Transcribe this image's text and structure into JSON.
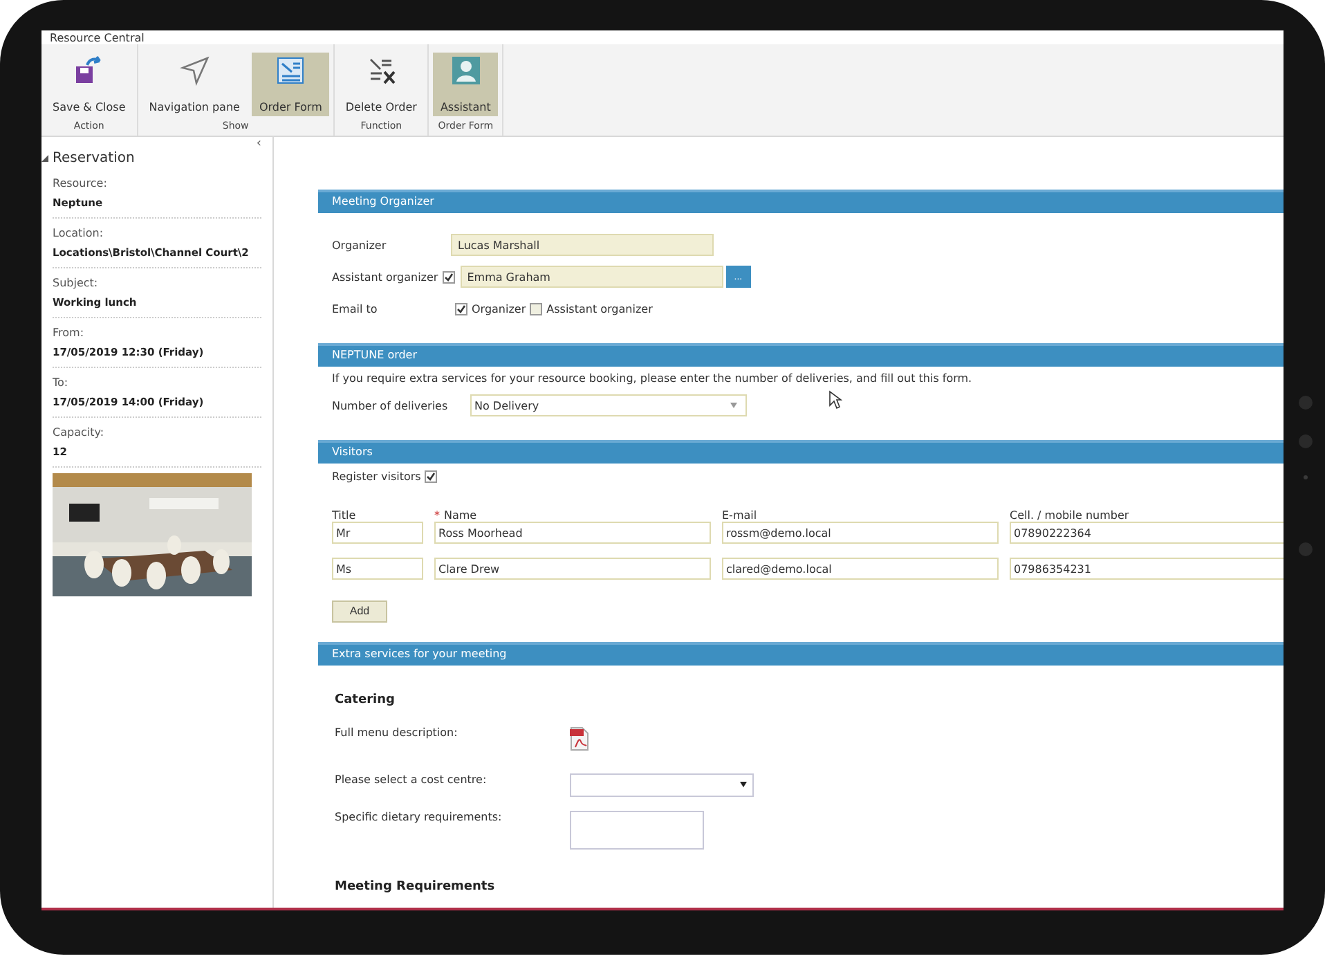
{
  "window": {
    "title": "Resource Central"
  },
  "ribbon": {
    "groups": [
      {
        "label": "Action",
        "buttons": [
          {
            "label": "Save & Close",
            "kind": "save",
            "selected": false
          }
        ]
      },
      {
        "label": "Show",
        "buttons": [
          {
            "label": "Navigation pane",
            "kind": "navigate",
            "selected": false
          },
          {
            "label": "Order Form",
            "kind": "form",
            "selected": true
          }
        ]
      },
      {
        "label": "Function",
        "buttons": [
          {
            "label": "Delete Order",
            "kind": "delete",
            "selected": false
          }
        ]
      },
      {
        "label": "Order Form",
        "buttons": [
          {
            "label": "Assistant",
            "kind": "person",
            "selected": true
          }
        ]
      }
    ]
  },
  "sidebar": {
    "collapse": "‹",
    "heading": "Reservation",
    "expanded": true,
    "fields": [
      {
        "label": "Resource:",
        "value": "Neptune"
      },
      {
        "label": "Location:",
        "value": "Locations\\Bristol\\Channel Court\\2"
      },
      {
        "label": "Subject:",
        "value": "Working lunch"
      },
      {
        "label": "From:",
        "value": "17/05/2019 12:30 (Friday)"
      },
      {
        "label": "To:",
        "value": "17/05/2019 14:00 (Friday)"
      },
      {
        "label": "Capacity:",
        "value": "12"
      }
    ]
  },
  "organizer": {
    "title": "Meeting Organizer",
    "organizer_label": "Organizer",
    "organizer": "Lucas Marshall",
    "assistant_label": "Assistant organizer",
    "assistant_checked": true,
    "assistant": "Emma Graham",
    "browse": "...",
    "email_label": "Email to",
    "email_options": [
      {
        "label": "Organizer",
        "checked": true
      },
      {
        "label": "Assistant organizer",
        "checked": false
      }
    ]
  },
  "order": {
    "title": "NEPTUNE order",
    "note": "If you require extra services for your resource booking, please enter the number of deliveries, and fill out this form.",
    "deliveries_label": "Number of deliveries",
    "deliveries": "No Delivery"
  },
  "visitors": {
    "title": "Visitors",
    "register_label": "Register visitors",
    "register_checked": true,
    "columns": [
      {
        "label": "Title"
      },
      {
        "label": "Name",
        "mark": "*"
      },
      {
        "label": "E-mail"
      },
      {
        "label": "Cell. / mobile number"
      }
    ],
    "rows": [
      [
        "Mr",
        "Ross Moorhead",
        "rossm@demo.local",
        "07890222364"
      ],
      [
        "Ms",
        "Clare Drew",
        "clared@demo.local",
        "07986354231"
      ]
    ],
    "add": "Add"
  },
  "extra": {
    "title": "Extra services for your meeting",
    "subtitle": "Catering",
    "menu_label": "Full menu description:",
    "cost_label": "Please select a cost centre:",
    "dietary_label": "Specific dietary requirements:",
    "next_subtitle": "Meeting Requirements"
  }
}
